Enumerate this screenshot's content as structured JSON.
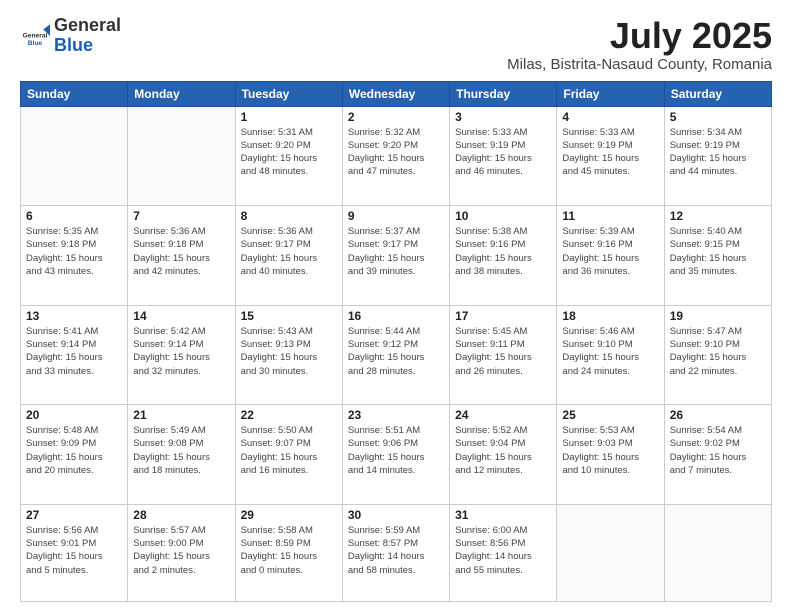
{
  "header": {
    "logo_general": "General",
    "logo_blue": "Blue",
    "month_title": "July 2025",
    "subtitle": "Milas, Bistrita-Nasaud County, Romania"
  },
  "weekdays": [
    "Sunday",
    "Monday",
    "Tuesday",
    "Wednesday",
    "Thursday",
    "Friday",
    "Saturday"
  ],
  "weeks": [
    [
      {
        "day": "",
        "info": ""
      },
      {
        "day": "",
        "info": ""
      },
      {
        "day": "1",
        "info": "Sunrise: 5:31 AM\nSunset: 9:20 PM\nDaylight: 15 hours\nand 48 minutes."
      },
      {
        "day": "2",
        "info": "Sunrise: 5:32 AM\nSunset: 9:20 PM\nDaylight: 15 hours\nand 47 minutes."
      },
      {
        "day": "3",
        "info": "Sunrise: 5:33 AM\nSunset: 9:19 PM\nDaylight: 15 hours\nand 46 minutes."
      },
      {
        "day": "4",
        "info": "Sunrise: 5:33 AM\nSunset: 9:19 PM\nDaylight: 15 hours\nand 45 minutes."
      },
      {
        "day": "5",
        "info": "Sunrise: 5:34 AM\nSunset: 9:19 PM\nDaylight: 15 hours\nand 44 minutes."
      }
    ],
    [
      {
        "day": "6",
        "info": "Sunrise: 5:35 AM\nSunset: 9:18 PM\nDaylight: 15 hours\nand 43 minutes."
      },
      {
        "day": "7",
        "info": "Sunrise: 5:36 AM\nSunset: 9:18 PM\nDaylight: 15 hours\nand 42 minutes."
      },
      {
        "day": "8",
        "info": "Sunrise: 5:36 AM\nSunset: 9:17 PM\nDaylight: 15 hours\nand 40 minutes."
      },
      {
        "day": "9",
        "info": "Sunrise: 5:37 AM\nSunset: 9:17 PM\nDaylight: 15 hours\nand 39 minutes."
      },
      {
        "day": "10",
        "info": "Sunrise: 5:38 AM\nSunset: 9:16 PM\nDaylight: 15 hours\nand 38 minutes."
      },
      {
        "day": "11",
        "info": "Sunrise: 5:39 AM\nSunset: 9:16 PM\nDaylight: 15 hours\nand 36 minutes."
      },
      {
        "day": "12",
        "info": "Sunrise: 5:40 AM\nSunset: 9:15 PM\nDaylight: 15 hours\nand 35 minutes."
      }
    ],
    [
      {
        "day": "13",
        "info": "Sunrise: 5:41 AM\nSunset: 9:14 PM\nDaylight: 15 hours\nand 33 minutes."
      },
      {
        "day": "14",
        "info": "Sunrise: 5:42 AM\nSunset: 9:14 PM\nDaylight: 15 hours\nand 32 minutes."
      },
      {
        "day": "15",
        "info": "Sunrise: 5:43 AM\nSunset: 9:13 PM\nDaylight: 15 hours\nand 30 minutes."
      },
      {
        "day": "16",
        "info": "Sunrise: 5:44 AM\nSunset: 9:12 PM\nDaylight: 15 hours\nand 28 minutes."
      },
      {
        "day": "17",
        "info": "Sunrise: 5:45 AM\nSunset: 9:11 PM\nDaylight: 15 hours\nand 26 minutes."
      },
      {
        "day": "18",
        "info": "Sunrise: 5:46 AM\nSunset: 9:10 PM\nDaylight: 15 hours\nand 24 minutes."
      },
      {
        "day": "19",
        "info": "Sunrise: 5:47 AM\nSunset: 9:10 PM\nDaylight: 15 hours\nand 22 minutes."
      }
    ],
    [
      {
        "day": "20",
        "info": "Sunrise: 5:48 AM\nSunset: 9:09 PM\nDaylight: 15 hours\nand 20 minutes."
      },
      {
        "day": "21",
        "info": "Sunrise: 5:49 AM\nSunset: 9:08 PM\nDaylight: 15 hours\nand 18 minutes."
      },
      {
        "day": "22",
        "info": "Sunrise: 5:50 AM\nSunset: 9:07 PM\nDaylight: 15 hours\nand 16 minutes."
      },
      {
        "day": "23",
        "info": "Sunrise: 5:51 AM\nSunset: 9:06 PM\nDaylight: 15 hours\nand 14 minutes."
      },
      {
        "day": "24",
        "info": "Sunrise: 5:52 AM\nSunset: 9:04 PM\nDaylight: 15 hours\nand 12 minutes."
      },
      {
        "day": "25",
        "info": "Sunrise: 5:53 AM\nSunset: 9:03 PM\nDaylight: 15 hours\nand 10 minutes."
      },
      {
        "day": "26",
        "info": "Sunrise: 5:54 AM\nSunset: 9:02 PM\nDaylight: 15 hours\nand 7 minutes."
      }
    ],
    [
      {
        "day": "27",
        "info": "Sunrise: 5:56 AM\nSunset: 9:01 PM\nDaylight: 15 hours\nand 5 minutes."
      },
      {
        "day": "28",
        "info": "Sunrise: 5:57 AM\nSunset: 9:00 PM\nDaylight: 15 hours\nand 2 minutes."
      },
      {
        "day": "29",
        "info": "Sunrise: 5:58 AM\nSunset: 8:59 PM\nDaylight: 15 hours\nand 0 minutes."
      },
      {
        "day": "30",
        "info": "Sunrise: 5:59 AM\nSunset: 8:57 PM\nDaylight: 14 hours\nand 58 minutes."
      },
      {
        "day": "31",
        "info": "Sunrise: 6:00 AM\nSunset: 8:56 PM\nDaylight: 14 hours\nand 55 minutes."
      },
      {
        "day": "",
        "info": ""
      },
      {
        "day": "",
        "info": ""
      }
    ]
  ]
}
